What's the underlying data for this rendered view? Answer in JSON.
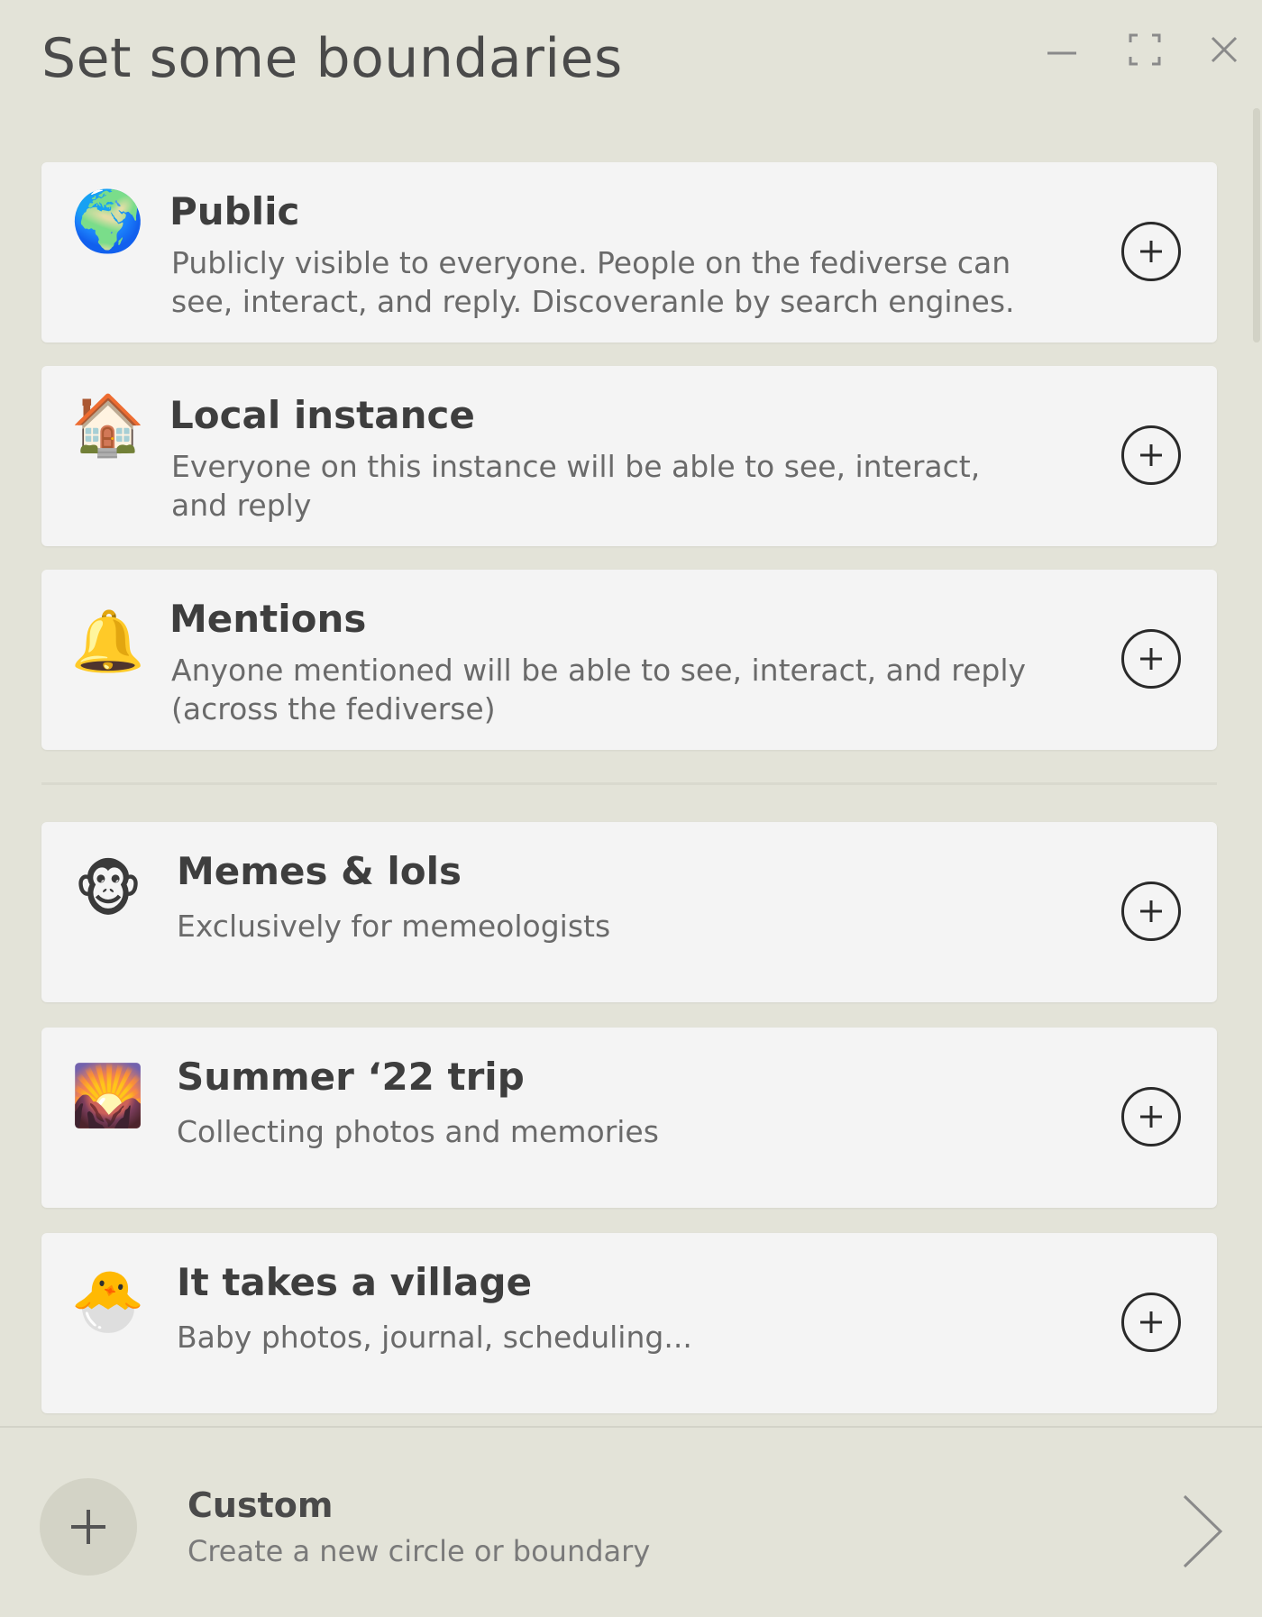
{
  "header": {
    "title": "Set some boundaries",
    "controls": {
      "minimize_icon": "minimize-icon",
      "expand_icon": "expand-icon",
      "close_icon": "close-icon"
    }
  },
  "boundaries": [
    {
      "icon": "globe-emoji",
      "emoji": "🌍",
      "title": "Public",
      "description": "Publicly visible to everyone. People on the fediverse can see, interact, and reply. Discoveranle by search engines."
    },
    {
      "icon": "house-emoji",
      "emoji": "🏠",
      "title": "Local instance",
      "description": "Everyone on this instance will be able to see, interact, and reply"
    },
    {
      "icon": "bell-emoji",
      "emoji": "🔔",
      "title": "Mentions",
      "description": "Anyone mentioned will be able to see, interact, and reply (across the fediverse)"
    }
  ],
  "circles": [
    {
      "icon": "monkey-face-emoji",
      "emoji": "🐵",
      "title": "Memes & lols",
      "description": "Exclusively for memeologists"
    },
    {
      "icon": "sunrise-over-mountains-emoji",
      "emoji": "🌄",
      "title": "Summer ‘22 trip",
      "description": "Collecting photos and memories"
    },
    {
      "icon": "hatching-chick-emoji",
      "emoji": "🐣",
      "title": "It takes a village",
      "description": "Baby photos, journal, scheduling..."
    }
  ],
  "footer": {
    "title": "Custom",
    "description": "Create a new circle or boundary"
  },
  "colors": {
    "background": "#e3e3d8",
    "card": "#f4f4f4",
    "text_primary": "#3e3e3e",
    "text_secondary": "#6a6a6a",
    "footer_circle": "#d3d3c6"
  }
}
